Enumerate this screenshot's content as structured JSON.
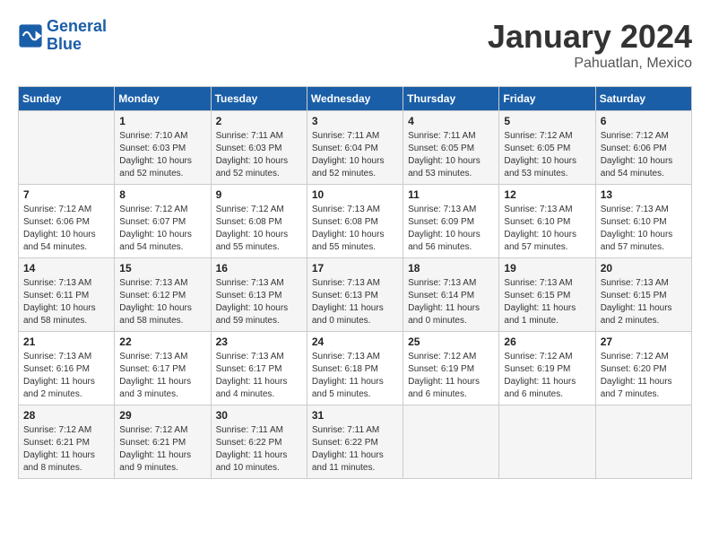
{
  "logo": {
    "text_general": "General",
    "text_blue": "Blue"
  },
  "header": {
    "title": "January 2024",
    "subtitle": "Pahuatlan, Mexico"
  },
  "weekdays": [
    "Sunday",
    "Monday",
    "Tuesday",
    "Wednesday",
    "Thursday",
    "Friday",
    "Saturday"
  ],
  "weeks": [
    [
      {
        "day": "",
        "sunrise": "",
        "sunset": "",
        "daylight": ""
      },
      {
        "day": "1",
        "sunrise": "Sunrise: 7:10 AM",
        "sunset": "Sunset: 6:03 PM",
        "daylight": "Daylight: 10 hours and 52 minutes."
      },
      {
        "day": "2",
        "sunrise": "Sunrise: 7:11 AM",
        "sunset": "Sunset: 6:03 PM",
        "daylight": "Daylight: 10 hours and 52 minutes."
      },
      {
        "day": "3",
        "sunrise": "Sunrise: 7:11 AM",
        "sunset": "Sunset: 6:04 PM",
        "daylight": "Daylight: 10 hours and 52 minutes."
      },
      {
        "day": "4",
        "sunrise": "Sunrise: 7:11 AM",
        "sunset": "Sunset: 6:05 PM",
        "daylight": "Daylight: 10 hours and 53 minutes."
      },
      {
        "day": "5",
        "sunrise": "Sunrise: 7:12 AM",
        "sunset": "Sunset: 6:05 PM",
        "daylight": "Daylight: 10 hours and 53 minutes."
      },
      {
        "day": "6",
        "sunrise": "Sunrise: 7:12 AM",
        "sunset": "Sunset: 6:06 PM",
        "daylight": "Daylight: 10 hours and 54 minutes."
      }
    ],
    [
      {
        "day": "7",
        "sunrise": "Sunrise: 7:12 AM",
        "sunset": "Sunset: 6:06 PM",
        "daylight": "Daylight: 10 hours and 54 minutes."
      },
      {
        "day": "8",
        "sunrise": "Sunrise: 7:12 AM",
        "sunset": "Sunset: 6:07 PM",
        "daylight": "Daylight: 10 hours and 54 minutes."
      },
      {
        "day": "9",
        "sunrise": "Sunrise: 7:12 AM",
        "sunset": "Sunset: 6:08 PM",
        "daylight": "Daylight: 10 hours and 55 minutes."
      },
      {
        "day": "10",
        "sunrise": "Sunrise: 7:13 AM",
        "sunset": "Sunset: 6:08 PM",
        "daylight": "Daylight: 10 hours and 55 minutes."
      },
      {
        "day": "11",
        "sunrise": "Sunrise: 7:13 AM",
        "sunset": "Sunset: 6:09 PM",
        "daylight": "Daylight: 10 hours and 56 minutes."
      },
      {
        "day": "12",
        "sunrise": "Sunrise: 7:13 AM",
        "sunset": "Sunset: 6:10 PM",
        "daylight": "Daylight: 10 hours and 57 minutes."
      },
      {
        "day": "13",
        "sunrise": "Sunrise: 7:13 AM",
        "sunset": "Sunset: 6:10 PM",
        "daylight": "Daylight: 10 hours and 57 minutes."
      }
    ],
    [
      {
        "day": "14",
        "sunrise": "Sunrise: 7:13 AM",
        "sunset": "Sunset: 6:11 PM",
        "daylight": "Daylight: 10 hours and 58 minutes."
      },
      {
        "day": "15",
        "sunrise": "Sunrise: 7:13 AM",
        "sunset": "Sunset: 6:12 PM",
        "daylight": "Daylight: 10 hours and 58 minutes."
      },
      {
        "day": "16",
        "sunrise": "Sunrise: 7:13 AM",
        "sunset": "Sunset: 6:13 PM",
        "daylight": "Daylight: 10 hours and 59 minutes."
      },
      {
        "day": "17",
        "sunrise": "Sunrise: 7:13 AM",
        "sunset": "Sunset: 6:13 PM",
        "daylight": "Daylight: 11 hours and 0 minutes."
      },
      {
        "day": "18",
        "sunrise": "Sunrise: 7:13 AM",
        "sunset": "Sunset: 6:14 PM",
        "daylight": "Daylight: 11 hours and 0 minutes."
      },
      {
        "day": "19",
        "sunrise": "Sunrise: 7:13 AM",
        "sunset": "Sunset: 6:15 PM",
        "daylight": "Daylight: 11 hours and 1 minute."
      },
      {
        "day": "20",
        "sunrise": "Sunrise: 7:13 AM",
        "sunset": "Sunset: 6:15 PM",
        "daylight": "Daylight: 11 hours and 2 minutes."
      }
    ],
    [
      {
        "day": "21",
        "sunrise": "Sunrise: 7:13 AM",
        "sunset": "Sunset: 6:16 PM",
        "daylight": "Daylight: 11 hours and 2 minutes."
      },
      {
        "day": "22",
        "sunrise": "Sunrise: 7:13 AM",
        "sunset": "Sunset: 6:17 PM",
        "daylight": "Daylight: 11 hours and 3 minutes."
      },
      {
        "day": "23",
        "sunrise": "Sunrise: 7:13 AM",
        "sunset": "Sunset: 6:17 PM",
        "daylight": "Daylight: 11 hours and 4 minutes."
      },
      {
        "day": "24",
        "sunrise": "Sunrise: 7:13 AM",
        "sunset": "Sunset: 6:18 PM",
        "daylight": "Daylight: 11 hours and 5 minutes."
      },
      {
        "day": "25",
        "sunrise": "Sunrise: 7:12 AM",
        "sunset": "Sunset: 6:19 PM",
        "daylight": "Daylight: 11 hours and 6 minutes."
      },
      {
        "day": "26",
        "sunrise": "Sunrise: 7:12 AM",
        "sunset": "Sunset: 6:19 PM",
        "daylight": "Daylight: 11 hours and 6 minutes."
      },
      {
        "day": "27",
        "sunrise": "Sunrise: 7:12 AM",
        "sunset": "Sunset: 6:20 PM",
        "daylight": "Daylight: 11 hours and 7 minutes."
      }
    ],
    [
      {
        "day": "28",
        "sunrise": "Sunrise: 7:12 AM",
        "sunset": "Sunset: 6:21 PM",
        "daylight": "Daylight: 11 hours and 8 minutes."
      },
      {
        "day": "29",
        "sunrise": "Sunrise: 7:12 AM",
        "sunset": "Sunset: 6:21 PM",
        "daylight": "Daylight: 11 hours and 9 minutes."
      },
      {
        "day": "30",
        "sunrise": "Sunrise: 7:11 AM",
        "sunset": "Sunset: 6:22 PM",
        "daylight": "Daylight: 11 hours and 10 minutes."
      },
      {
        "day": "31",
        "sunrise": "Sunrise: 7:11 AM",
        "sunset": "Sunset: 6:22 PM",
        "daylight": "Daylight: 11 hours and 11 minutes."
      },
      {
        "day": "",
        "sunrise": "",
        "sunset": "",
        "daylight": ""
      },
      {
        "day": "",
        "sunrise": "",
        "sunset": "",
        "daylight": ""
      },
      {
        "day": "",
        "sunrise": "",
        "sunset": "",
        "daylight": ""
      }
    ]
  ]
}
